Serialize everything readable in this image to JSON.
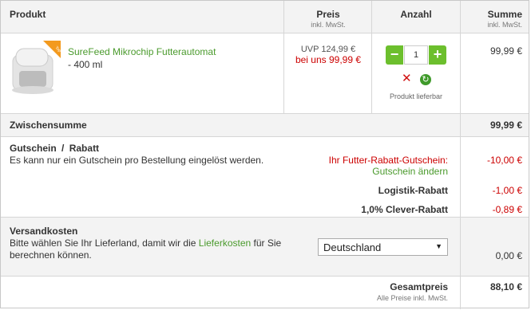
{
  "header": {
    "product": "Produkt",
    "price": "Preis",
    "price_sub": "inkl. MwSt.",
    "quantity": "Anzahl",
    "total": "Summe",
    "total_sub": "inkl. MwSt."
  },
  "item": {
    "name": "SureFeed Mikrochip Futterautomat",
    "variant": "- 400 ml",
    "uvp": "UVP 124,99 €",
    "our_price": "bei uns 99,99 €",
    "quantity": "1",
    "availability": "Produkt lieferbar",
    "sum": "99,99 €",
    "colors": {
      "accent_green": "#6cbf2d",
      "price_red": "#cc0000",
      "badge_orange": "#f39a1e"
    }
  },
  "subtotal": {
    "label": "Zwischensumme",
    "value": "99,99 €"
  },
  "voucher": {
    "title": "Gutschein",
    "separator": "/",
    "title2": "Rabatt",
    "note": "Es kann nur ein Gutschein pro Bestellung eingelöst werden.",
    "coupon_label": "Ihr Futter-Rabatt-Gutschein:",
    "coupon_value": "-10,00 €",
    "change_link": "Gutschein ändern",
    "logistics_label": "Logistik-Rabatt",
    "logistics_value": "-1,00 €",
    "clever_label": "1,0% Clever-Rabatt",
    "clever_value": "-0,89 €"
  },
  "shipping": {
    "title": "Versandkosten",
    "text_before": "Bitte wählen Sie Ihr Lieferland, damit wir die",
    "link": "Lieferkosten",
    "text_after": "für Sie",
    "text_line2": "berechnen können.",
    "country": "Deutschland",
    "value": "0,00 €"
  },
  "total": {
    "label": "Gesamtpreis",
    "note": "Alle Preise inkl. MwSt.",
    "value": "88,10 €"
  }
}
